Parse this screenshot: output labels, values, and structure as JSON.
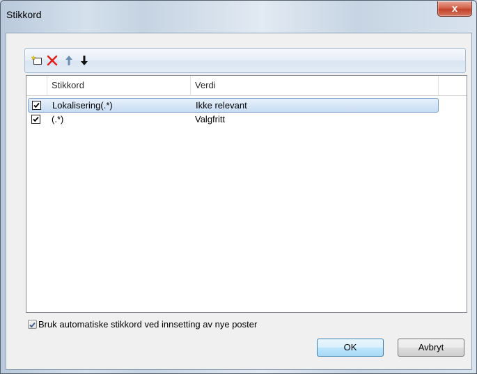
{
  "window": {
    "title": "Stikkord",
    "close_symbol": "x"
  },
  "toolbar": {
    "buttons": [
      {
        "name": "new-icon"
      },
      {
        "name": "delete-icon"
      },
      {
        "name": "arrow-up-icon"
      },
      {
        "name": "arrow-down-icon"
      }
    ]
  },
  "table": {
    "columns": [
      "Stikkord",
      "Verdi"
    ],
    "rows": [
      {
        "checked": true,
        "stikkord": "Lokalisering(.*)",
        "verdi": "Ikke relevant",
        "selected": true
      },
      {
        "checked": true,
        "stikkord": "(.*)",
        "verdi": "Valgfritt",
        "selected": false
      }
    ]
  },
  "options": {
    "auto_keywords_label": "Bruk automatiske stikkord ved innsetting av nye poster",
    "auto_keywords_checked": true
  },
  "buttons": {
    "ok_label": "OK",
    "cancel_label": "Avbryt"
  },
  "colors": {
    "delete_icon": "#e0201c",
    "selection": "#cfe2f6",
    "checkbox_check": "#3a5b8c"
  }
}
